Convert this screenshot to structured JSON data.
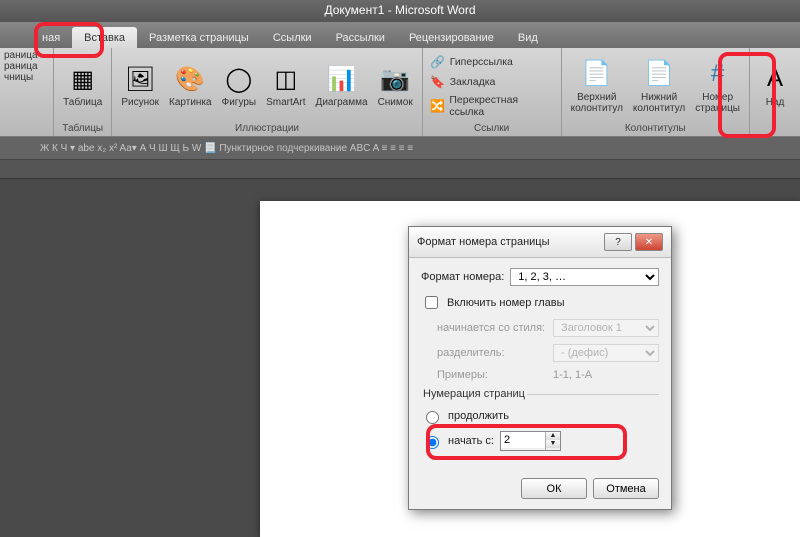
{
  "title": "Документ1 - Microsoft Word",
  "tabs": {
    "t0": "ная",
    "t1": "Вставка",
    "t2": "Разметка страницы",
    "t3": "Ссылки",
    "t4": "Рассылки",
    "t5": "Рецензирование",
    "t6": "Вид"
  },
  "ribbon": {
    "pages": {
      "btn0": "раница",
      "btn1": "раница",
      "btn2": "чницы"
    },
    "tables": {
      "label": "Таблица",
      "group": "Таблицы"
    },
    "illus": {
      "pic": "Рисунок",
      "clip": "Картинка",
      "shapes": "Фигуры",
      "smartart": "SmartArt",
      "chart": "Диаграмма",
      "screenshot": "Снимок",
      "group": "Иллюстрации"
    },
    "links": {
      "hyper": "Гиперссылка",
      "book": "Закладка",
      "cross": "Перекрестная ссылка",
      "group": "Ссылки"
    },
    "hf": {
      "header": "Верхний\nколонтитул",
      "footer": "Нижний\nколонтитул",
      "pagenum": "Номер\nстраницы",
      "group": "Колонтитулы"
    },
    "text": {
      "btn": "Над"
    }
  },
  "fmtbar": "Ж  К  Ч ▾ abe  x₂  x²   Aa▾   А  Ч  Ш  Щ  Ь  W   📃 Пунктирное подчеркивание   ABC  A  ≡ ≡ ≡ ≡",
  "dialog": {
    "title": "Формат номера страницы",
    "format_label": "Формат номера:",
    "format_value": "1, 2, 3, …",
    "include_chapter": "Включить номер главы",
    "starts_style": "начинается со стиля:",
    "starts_style_val": "Заголовок 1",
    "separator": "разделитель:",
    "separator_val": "-   (дефис)",
    "examples": "Примеры:",
    "examples_val": "1-1, 1-A",
    "numbering_legend": "Нумерация страниц",
    "continue": "продолжить",
    "start_at": "начать с:",
    "start_val": "2",
    "ok": "ОК",
    "cancel": "Отмена"
  }
}
